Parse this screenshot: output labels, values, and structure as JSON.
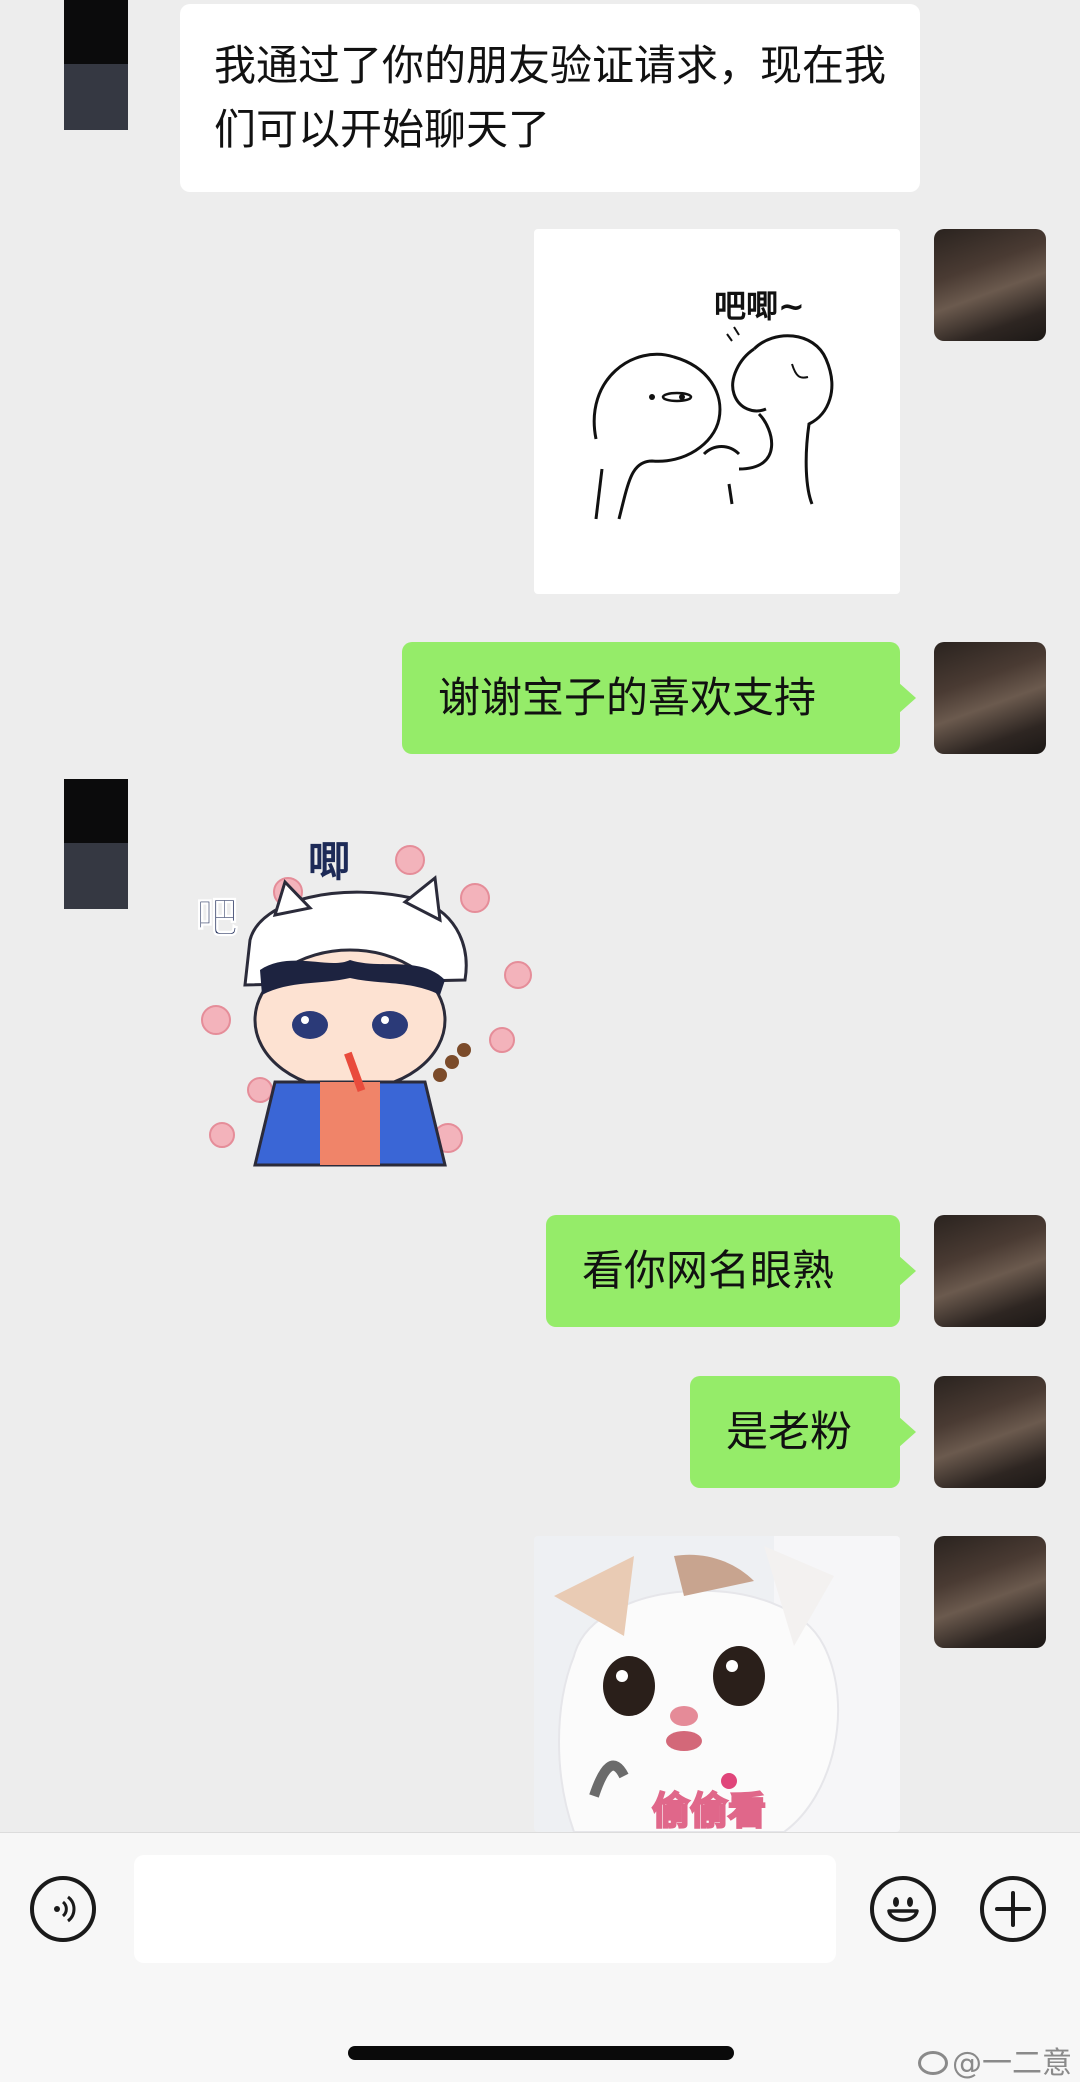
{
  "chat": {
    "messages": [
      {
        "side": "left",
        "type": "text",
        "text": "我通过了你的朋友验证请求，现在我们可以开始聊天了"
      },
      {
        "side": "right",
        "type": "sticker",
        "sticker_text": "吧唧~"
      },
      {
        "side": "right",
        "type": "text",
        "text": "谢谢宝子的喜欢支持"
      },
      {
        "side": "left",
        "type": "sticker",
        "sticker_text_1": "吧",
        "sticker_text_2": "唧"
      },
      {
        "side": "right",
        "type": "text",
        "text": "看你网名眼熟"
      },
      {
        "side": "right",
        "type": "text",
        "text": "是老粉"
      },
      {
        "side": "right",
        "type": "sticker",
        "sticker_text": "偷偷看"
      }
    ]
  },
  "watermark": "@一二意",
  "colors": {
    "background": "#ededed",
    "bubble_green": "#95ec69",
    "bubble_white": "#ffffff"
  },
  "icons": [
    "voice-icon",
    "emoji-icon",
    "plus-icon",
    "weibo-icon"
  ]
}
